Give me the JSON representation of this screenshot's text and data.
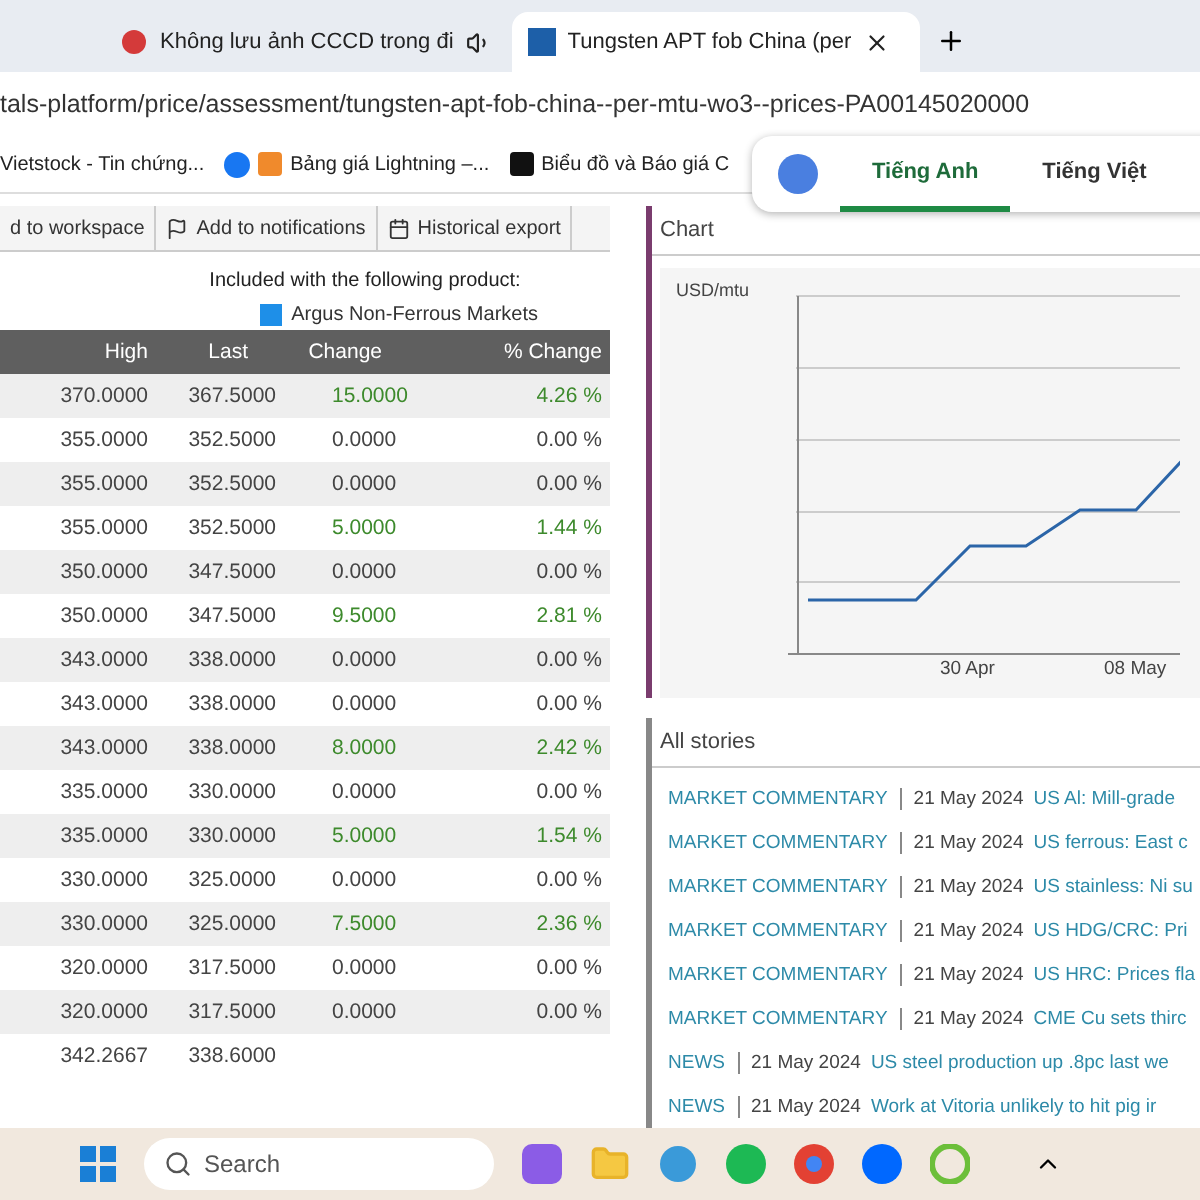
{
  "browser": {
    "tabs": [
      {
        "title": "Không lưu ảnh CCCD trong đi",
        "selected": false,
        "audio": true
      },
      {
        "title": "Tungsten APT fob China (per",
        "selected": true,
        "audio": false
      }
    ],
    "address": "tals-platform/price/assessment/tungsten-apt-fob-china--per-mtu-wo3--prices-PA00145020000",
    "bookmarks": [
      {
        "label": "Vietstock - Tin chứng...",
        "kind": "plain"
      },
      {
        "label": "Bảng giá Lightning –...",
        "kind": "orange"
      },
      {
        "label": "Biểu đồ và Báo giá C",
        "kind": "dark"
      }
    ]
  },
  "translate_popup": {
    "languages": [
      {
        "label": "Tiếng Anh",
        "selected": true
      },
      {
        "label": "Tiếng Việt",
        "selected": false
      }
    ]
  },
  "toolbar": [
    "d to workspace",
    "Add to notifications",
    "Historical export"
  ],
  "product": {
    "caption": "Included with the following product:",
    "name": "Argus Non-Ferrous Markets",
    "color": "#1e8fe8"
  },
  "table": {
    "columns": [
      "High",
      "Last",
      "Change",
      "% Change"
    ],
    "rows": [
      {
        "high": "370.0000",
        "last": "367.5000",
        "change": "15.0000",
        "pct": "4.26 %",
        "up": true
      },
      {
        "high": "355.0000",
        "last": "352.5000",
        "change": "0.0000",
        "pct": "0.00 %",
        "up": false
      },
      {
        "high": "355.0000",
        "last": "352.5000",
        "change": "0.0000",
        "pct": "0.00 %",
        "up": false
      },
      {
        "high": "355.0000",
        "last": "352.5000",
        "change": "5.0000",
        "pct": "1.44 %",
        "up": true
      },
      {
        "high": "350.0000",
        "last": "347.5000",
        "change": "0.0000",
        "pct": "0.00 %",
        "up": false
      },
      {
        "high": "350.0000",
        "last": "347.5000",
        "change": "9.5000",
        "pct": "2.81 %",
        "up": true
      },
      {
        "high": "343.0000",
        "last": "338.0000",
        "change": "0.0000",
        "pct": "0.00 %",
        "up": false
      },
      {
        "high": "343.0000",
        "last": "338.0000",
        "change": "0.0000",
        "pct": "0.00 %",
        "up": false
      },
      {
        "high": "343.0000",
        "last": "338.0000",
        "change": "8.0000",
        "pct": "2.42 %",
        "up": true
      },
      {
        "high": "335.0000",
        "last": "330.0000",
        "change": "0.0000",
        "pct": "0.00 %",
        "up": false
      },
      {
        "high": "335.0000",
        "last": "330.0000",
        "change": "5.0000",
        "pct": "1.54 %",
        "up": true
      },
      {
        "high": "330.0000",
        "last": "325.0000",
        "change": "0.0000",
        "pct": "0.00 %",
        "up": false
      },
      {
        "high": "330.0000",
        "last": "325.0000",
        "change": "7.5000",
        "pct": "2.36 %",
        "up": true
      },
      {
        "high": "320.0000",
        "last": "317.5000",
        "change": "0.0000",
        "pct": "0.00 %",
        "up": false
      },
      {
        "high": "320.0000",
        "last": "317.5000",
        "change": "0.0000",
        "pct": "0.00 %",
        "up": false
      }
    ],
    "average": {
      "high": "342.2667",
      "last": "338.6000"
    }
  },
  "chart": {
    "title": "Chart",
    "unit": "USD/mtu",
    "x_labels": [
      "30 Apr",
      "08 May"
    ]
  },
  "stories": {
    "title": "All stories",
    "items": [
      {
        "type": "MARKET COMMENTARY",
        "date": "21 May 2024",
        "headline": "US Al: Mill-grade"
      },
      {
        "type": "MARKET COMMENTARY",
        "date": "21 May 2024",
        "headline": "US ferrous: East c"
      },
      {
        "type": "MARKET COMMENTARY",
        "date": "21 May 2024",
        "headline": "US stainless: Ni su"
      },
      {
        "type": "MARKET COMMENTARY",
        "date": "21 May 2024",
        "headline": "US HDG/CRC: Pri"
      },
      {
        "type": "MARKET COMMENTARY",
        "date": "21 May 2024",
        "headline": "US HRC: Prices fla"
      },
      {
        "type": "MARKET COMMENTARY",
        "date": "21 May 2024",
        "headline": "CME Cu sets thirc"
      },
      {
        "type": "NEWS",
        "date": "21 May 2024",
        "headline": "US steel production up .8pc last we"
      },
      {
        "type": "NEWS",
        "date": "21 May 2024",
        "headline": "Work at Vitoria unlikely to hit pig ir"
      }
    ]
  },
  "taskbar": {
    "search_placeholder": "Search"
  }
}
